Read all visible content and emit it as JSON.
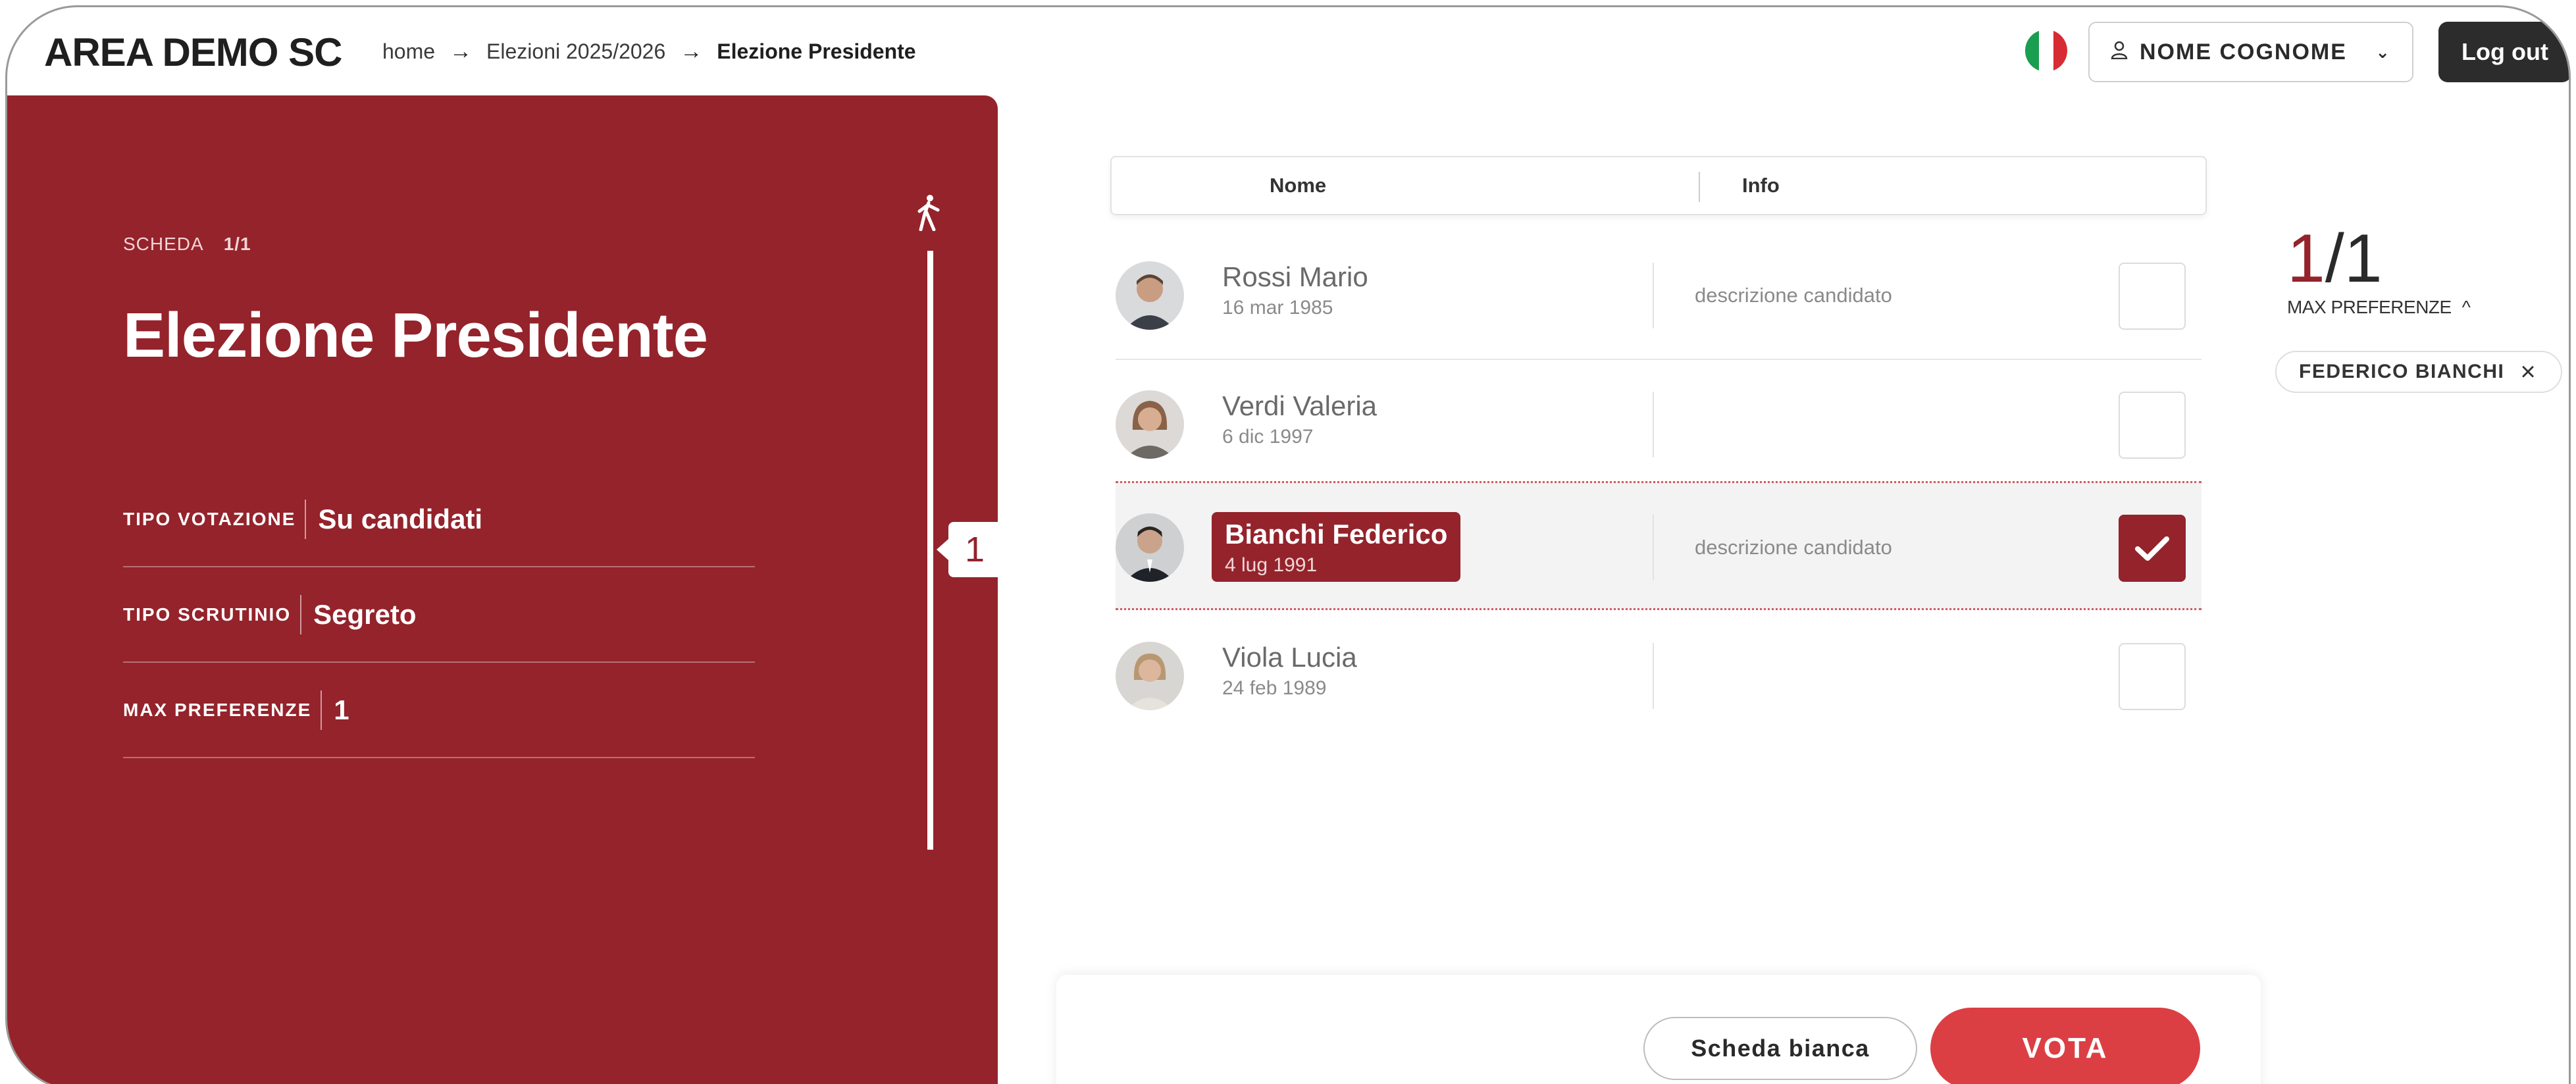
{
  "header": {
    "brand": "AREA DEMO SC",
    "breadcrumb": [
      "home",
      "Elezioni 2025/2026",
      "Elezione Presidente"
    ],
    "user_label": "NOME COGNOME",
    "logout_label": "Log out",
    "flag_colors": [
      "#1a9e4f",
      "#ffffff",
      "#d72c33"
    ]
  },
  "ballot": {
    "scheda_label": "SCHEDA",
    "scheda_value": "1/1",
    "title": "Elezione Presidente",
    "rows": [
      {
        "label": "TIPO VOTAZIONE",
        "value": "Su candidati"
      },
      {
        "label": "TIPO SCRUTINIO",
        "value": "Segreto"
      },
      {
        "label": "MAX PREFERENZE",
        "value": "1"
      }
    ],
    "step": "1"
  },
  "table": {
    "col_nome": "Nome",
    "col_info": "Info",
    "candidates": [
      {
        "name": "Rossi Mario",
        "date": "16 mar 1985",
        "info": "descrizione candidato",
        "selected": false
      },
      {
        "name": "Verdi Valeria",
        "date": "6 dic 1997",
        "info": "",
        "selected": false
      },
      {
        "name": "Bianchi Federico",
        "date": "4 lug 1991",
        "info": "descrizione candidato",
        "selected": true
      },
      {
        "name": "Viola Lucia",
        "date": "24 feb 1989",
        "info": "",
        "selected": false
      }
    ]
  },
  "summary": {
    "count_selected": "1",
    "count_sep": "/",
    "count_max": "1",
    "max_label": "MAX PREFERENZE",
    "chip_label": "FEDERICO BIANCHI"
  },
  "actions": {
    "blank_label": "Scheda bianca",
    "vote_label": "VOTA"
  },
  "colors": {
    "primary": "#94232b",
    "vote": "#db3f44"
  }
}
